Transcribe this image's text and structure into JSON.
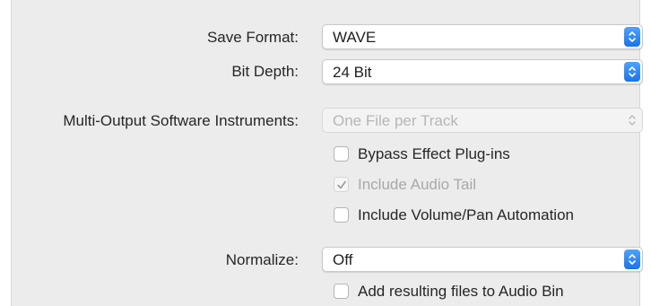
{
  "save_format": {
    "label": "Save Format:",
    "value": "WAVE"
  },
  "bit_depth": {
    "label": "Bit Depth:",
    "value": "24 Bit"
  },
  "multi_output": {
    "label": "Multi-Output Software Instruments:",
    "value": "One File per Track",
    "enabled": false
  },
  "options": [
    {
      "label": "Bypass Effect Plug-ins",
      "checked": false,
      "enabled": true
    },
    {
      "label": "Include Audio Tail",
      "checked": true,
      "enabled": false
    },
    {
      "label": "Include Volume/Pan Automation",
      "checked": false,
      "enabled": true
    }
  ],
  "normalize": {
    "label": "Normalize:",
    "value": "Off"
  },
  "add_to_bin": {
    "label": "Add resulting files to Audio Bin",
    "checked": false,
    "enabled": true
  },
  "icons": {
    "popup_stepper": "up-down-chevron-icon",
    "checkmark": "checkmark-icon"
  },
  "colors": {
    "accent": "#1a73e8",
    "panel_bg": "#ececec",
    "disabled_text": "#b6b6b6"
  }
}
